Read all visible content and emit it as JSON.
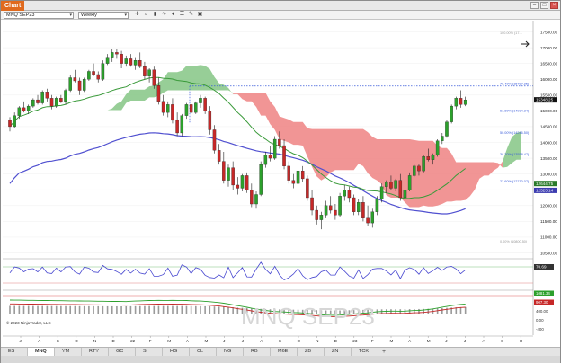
{
  "window": {
    "title": "Chart",
    "buttons": [
      "–",
      "□",
      "×"
    ]
  },
  "toolbar": {
    "instrument": "MNQ SEP23",
    "interval": "Weekly",
    "icons": [
      "crosshair-icon",
      "zoom-icon",
      "bars-icon",
      "indicator-icon",
      "strategy-icon",
      "properties-icon",
      "drawing-icon",
      "snapshot-icon"
    ]
  },
  "tabs": [
    "ES",
    "MNQ",
    "YM",
    "RTY",
    "GC",
    "SI",
    "HG",
    "CL",
    "NG",
    "RB",
    "M6E",
    "ZB",
    "ZN",
    "TCK"
  ],
  "active_tab": "MNQ",
  "copyright": "© 2023 NinjaTrader, LLC",
  "watermark": "MNQ SEP23",
  "colors": {
    "up_candle": "#2ca02c",
    "down_candle": "#c62828",
    "cloud_bull": "#8cc98c",
    "cloud_bear": "#f08a8a",
    "sma_slow": "#5050d0",
    "sma_fast": "#3a9a3a",
    "fib_line": "#3a5bd9"
  },
  "chart_data": [
    {
      "type": "candlestick",
      "title": "",
      "instrument": "MNQ SEP23",
      "interval": "Weekly",
      "x_tick_labels": [
        "J",
        "A",
        "S",
        "O",
        "N",
        "D",
        "22",
        "F",
        "M",
        "A",
        "M",
        "J",
        "J",
        "A",
        "S",
        "O",
        "N",
        "D",
        "23",
        "F",
        "M",
        "A",
        "M",
        "J",
        "J",
        "A",
        "S",
        "O"
      ],
      "y_tick_labels": [
        "17500.00",
        "17000.00",
        "16500.00",
        "16000.00",
        "15500.00",
        "15000.00",
        "14500.00",
        "14000.00",
        "13500.00",
        "13000.00",
        "12500.00",
        "12000.00",
        "11500.00",
        "11000.00",
        "10500.00"
      ],
      "ylim": [
        10400,
        17800
      ],
      "last_price_label": "15348.25",
      "sma_fast_label": "12644.75",
      "sma_slow_label": "12523.14",
      "fib_levels": [
        {
          "label": "100.00% (17...",
          "value": 17400
        },
        {
          "label": "76.40% (15787.25)",
          "value": 15787.25
        },
        {
          "label": "61.80% (14934.34)",
          "value": 14934.34
        },
        {
          "label": "50.00% (14246.50)",
          "value": 14246.5
        },
        {
          "label": "38.20% (13558.47)",
          "value": 13558.47
        },
        {
          "label": "23.60% (12710.07)",
          "value": 12710.07
        },
        {
          "label": "0.00% (10800.50)",
          "value": 10800.5
        }
      ],
      "candles": [
        [
          14700,
          14800,
          14350,
          14500
        ],
        [
          14500,
          14950,
          14450,
          14850
        ],
        [
          14850,
          15150,
          14750,
          15100
        ],
        [
          15100,
          15300,
          14950,
          15000
        ],
        [
          15000,
          15200,
          14900,
          15150
        ],
        [
          15150,
          15400,
          15100,
          15350
        ],
        [
          15350,
          15500,
          15200,
          15250
        ],
        [
          15250,
          15650,
          15200,
          15600
        ],
        [
          15600,
          15700,
          15300,
          15400
        ],
        [
          15400,
          15500,
          15050,
          15150
        ],
        [
          15150,
          15450,
          15100,
          15400
        ],
        [
          15400,
          15500,
          15250,
          15300
        ],
        [
          15300,
          15700,
          15200,
          15650
        ],
        [
          15650,
          16150,
          15600,
          16050
        ],
        [
          16050,
          16300,
          15900,
          15950
        ],
        [
          15950,
          16050,
          15500,
          15650
        ],
        [
          15650,
          16050,
          15600,
          16000
        ],
        [
          16000,
          16300,
          15950,
          16250
        ],
        [
          16250,
          16500,
          16100,
          16150
        ],
        [
          16150,
          16250,
          15900,
          16000
        ],
        [
          16000,
          16600,
          15950,
          16500
        ],
        [
          16500,
          16800,
          16450,
          16700
        ],
        [
          16700,
          16950,
          16550,
          16850
        ],
        [
          16850,
          16950,
          16650,
          16800
        ],
        [
          16800,
          16900,
          16350,
          16500
        ],
        [
          16500,
          16750,
          16400,
          16650
        ],
        [
          16650,
          16800,
          16400,
          16450
        ],
        [
          16450,
          16700,
          16300,
          16600
        ],
        [
          16600,
          16850,
          16350,
          16400
        ],
        [
          16400,
          16550,
          16000,
          16100
        ],
        [
          16100,
          16350,
          15900,
          16300
        ],
        [
          16300,
          16400,
          15700,
          15800
        ],
        [
          15800,
          16050,
          15200,
          15300
        ],
        [
          15300,
          15500,
          14850,
          14950
        ],
        [
          14950,
          15300,
          14800,
          15200
        ],
        [
          15200,
          15400,
          14600,
          14700
        ],
        [
          14700,
          14950,
          14200,
          14300
        ],
        [
          14300,
          14900,
          14200,
          14850
        ],
        [
          14850,
          15250,
          14750,
          15200
        ],
        [
          15200,
          15400,
          14850,
          14950
        ],
        [
          14950,
          15300,
          14900,
          15250
        ],
        [
          15250,
          15500,
          15100,
          15400
        ],
        [
          15400,
          15450,
          14900,
          15000
        ],
        [
          15000,
          15150,
          14250,
          14400
        ],
        [
          14400,
          14550,
          13650,
          13750
        ],
        [
          13750,
          13950,
          13300,
          13400
        ],
        [
          13400,
          13700,
          12700,
          12800
        ],
        [
          12800,
          13300,
          12600,
          13200
        ],
        [
          13200,
          13400,
          12500,
          12650
        ],
        [
          12650,
          12900,
          12350,
          12550
        ],
        [
          12550,
          13000,
          12450,
          12950
        ],
        [
          12950,
          13050,
          12400,
          12500
        ],
        [
          12500,
          12700,
          11950,
          12050
        ],
        [
          12050,
          12450,
          11900,
          12350
        ],
        [
          12350,
          13400,
          12300,
          13300
        ],
        [
          13300,
          13700,
          13200,
          13600
        ],
        [
          13600,
          13900,
          13400,
          13500
        ],
        [
          13500,
          14200,
          13450,
          14100
        ],
        [
          14100,
          14350,
          13800,
          13900
        ],
        [
          13900,
          14100,
          13150,
          13250
        ],
        [
          13250,
          13400,
          12700,
          12800
        ],
        [
          12800,
          13000,
          12550,
          12700
        ],
        [
          12700,
          13200,
          12650,
          13100
        ],
        [
          13100,
          13250,
          12750,
          12850
        ],
        [
          12850,
          12950,
          12150,
          12250
        ],
        [
          12250,
          12500,
          11700,
          11850
        ],
        [
          11850,
          12000,
          11400,
          11550
        ],
        [
          11550,
          11800,
          11250,
          11700
        ],
        [
          11700,
          12150,
          11600,
          12000
        ],
        [
          12000,
          12300,
          11750,
          11850
        ],
        [
          11850,
          12050,
          11550,
          11700
        ],
        [
          11700,
          12400,
          11650,
          12300
        ],
        [
          12300,
          12650,
          12150,
          12500
        ],
        [
          12500,
          12600,
          12100,
          12250
        ],
        [
          12250,
          12350,
          11700,
          11800
        ],
        [
          11800,
          12200,
          11700,
          12100
        ],
        [
          12100,
          12300,
          11500,
          11600
        ],
        [
          11600,
          12000,
          11350,
          11450
        ],
        [
          11450,
          11900,
          11300,
          11800
        ],
        [
          11800,
          12300,
          11700,
          12200
        ],
        [
          12200,
          12700,
          12100,
          12600
        ],
        [
          12600,
          12800,
          12400,
          12750
        ],
        [
          12750,
          12950,
          12500,
          12550
        ],
        [
          12550,
          12850,
          12450,
          12800
        ],
        [
          12800,
          13000,
          12150,
          12250
        ],
        [
          12250,
          12650,
          12100,
          12500
        ],
        [
          12500,
          13050,
          12450,
          12950
        ],
        [
          12950,
          13300,
          12900,
          13250
        ],
        [
          13250,
          13300,
          12950,
          13100
        ],
        [
          13100,
          13600,
          13050,
          13550
        ],
        [
          13550,
          13800,
          13400,
          13450
        ],
        [
          13450,
          13650,
          13300,
          13600
        ],
        [
          13600,
          14100,
          13550,
          14050
        ],
        [
          14050,
          14300,
          13950,
          14200
        ],
        [
          14200,
          14700,
          14150,
          14650
        ],
        [
          14650,
          15200,
          14600,
          15150
        ],
        [
          15150,
          15450,
          15050,
          15400
        ],
        [
          15400,
          15650,
          15100,
          15200
        ],
        [
          15200,
          15450,
          15150,
          15348.25
        ]
      ],
      "rsi": {
        "levels": [
          70,
          30
        ],
        "last_label": "70.69"
      },
      "macd": {
        "labels": [
          "1081.34",
          "907.30",
          "400.00",
          "0.00",
          "-400"
        ]
      }
    }
  ]
}
